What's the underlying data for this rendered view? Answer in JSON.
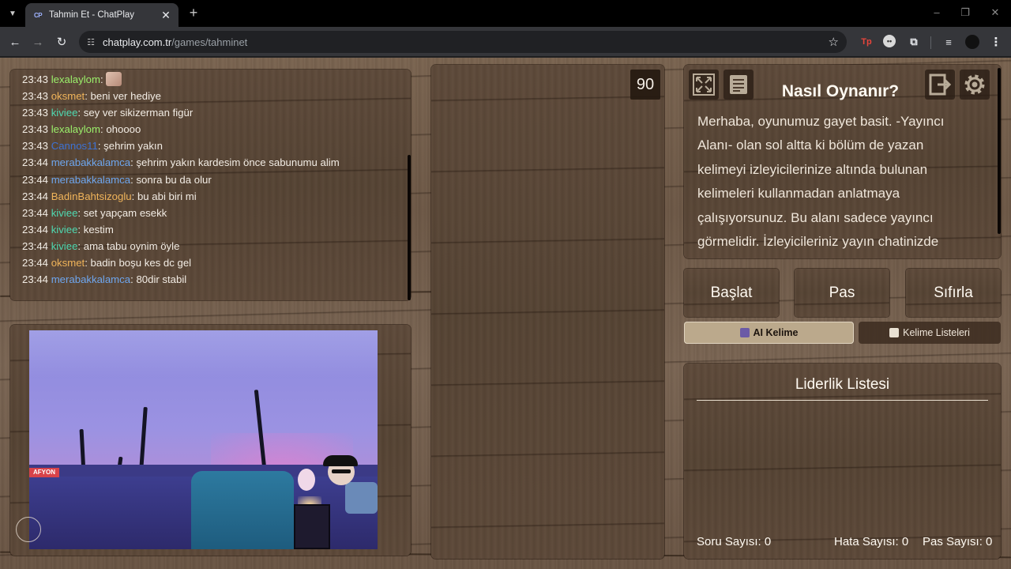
{
  "browser": {
    "tab_title": "Tahmin Et - ChatPlay",
    "tab_favicon": "CP",
    "url_domain": "chatplay.com.tr",
    "url_path": "/games/tahminet",
    "extension_tp": "Tp"
  },
  "chat": {
    "messages": [
      {
        "time": "23:43",
        "user": "lexalaylom",
        "color": "#9bf06b",
        "text": "",
        "emote": true
      },
      {
        "time": "23:43",
        "user": "oksmet",
        "color": "#f0b45a",
        "text": "beni ver hediye"
      },
      {
        "time": "23:43",
        "user": "kiviee",
        "color": "#4fd9b1",
        "text": "sey ver sikizerman figür"
      },
      {
        "time": "23:43",
        "user": "lexalaylom",
        "color": "#9bf06b",
        "text": "ohoooo"
      },
      {
        "time": "23:43",
        "user": "Cannos11",
        "color": "#3d72d4",
        "text": "şehrim yakın"
      },
      {
        "time": "23:44",
        "user": "merabakkalamca",
        "color": "#6ea6ee",
        "text": "şehrim yakın kardesim önce sabunumu alim"
      },
      {
        "time": "23:44",
        "user": "merabakkalamca",
        "color": "#6ea6ee",
        "text": "sonra bu da olur"
      },
      {
        "time": "23:44",
        "user": "BadinBahtsizoglu",
        "color": "#f0b45a",
        "text": "bu abi biri mi"
      },
      {
        "time": "23:44",
        "user": "kiviee",
        "color": "#4fd9b1",
        "text": "set yapçam esekk"
      },
      {
        "time": "23:44",
        "user": "kiviee",
        "color": "#4fd9b1",
        "text": "kestim"
      },
      {
        "time": "23:44",
        "user": "kiviee",
        "color": "#4fd9b1",
        "text": "ama tabu oynim öyle"
      },
      {
        "time": "23:44",
        "user": "oksmet",
        "color": "#f0b45a",
        "text": "badin boşu kes dc gel"
      },
      {
        "time": "23:44",
        "user": "merabakkalamca",
        "color": "#6ea6ee",
        "text": "80dir stabil"
      }
    ]
  },
  "camera": {
    "sign_text": "AFYON"
  },
  "timer": "90",
  "info": {
    "title": "Nasıl Oynanır?",
    "text": "Merhaba, oyunumuz gayet basit. -Yayıncı Alanı- olan sol altta ki bölüm de yazan kelimeyi izleyicilerinize altında bulunan kelimeleri kullanmadan anlatmaya çalışıyorsunuz. Bu alanı sadece yayıncı görmelidir. İzleyicileriniz yayın chatinizde"
  },
  "actions": {
    "start": "Başlat",
    "pass": "Pas",
    "reset": "Sıfırla"
  },
  "tabs": {
    "ai_word": "AI Kelime",
    "word_lists": "Kelime Listeleri"
  },
  "leaderboard": {
    "title": "Liderlik Listesi",
    "questions_label": "Soru Sayısı:",
    "questions_value": "0",
    "errors_label": "Hata Sayısı:",
    "errors_value": "0",
    "passes_label": "Pas Sayısı:",
    "passes_value": "0"
  },
  "icons": {
    "fullscreen": "fullscreen-icon",
    "rules": "document-icon",
    "exit": "exit-icon",
    "settings": "gear-icon"
  }
}
